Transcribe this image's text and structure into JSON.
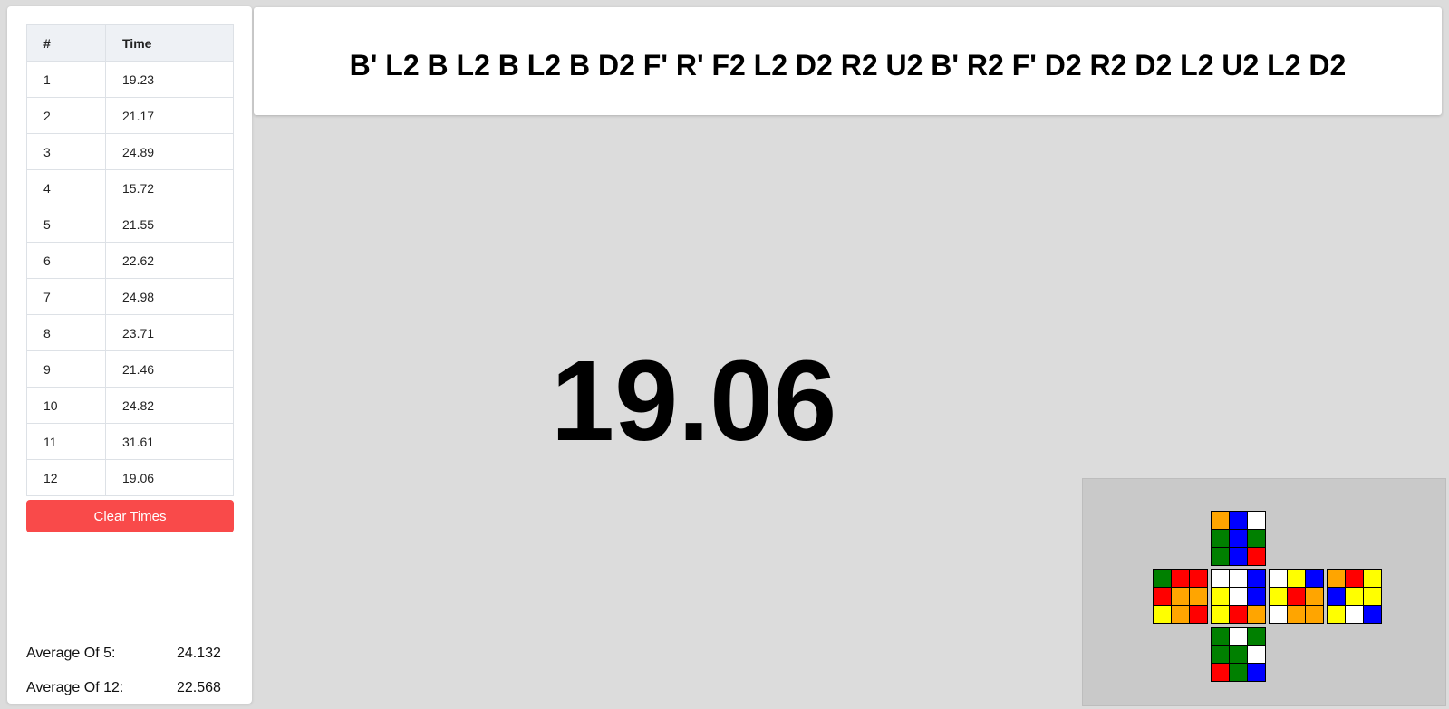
{
  "times": {
    "headers": {
      "num": "#",
      "time": "Time"
    },
    "rows": [
      {
        "num": "1",
        "time": "19.23"
      },
      {
        "num": "2",
        "time": "21.17"
      },
      {
        "num": "3",
        "time": "24.89"
      },
      {
        "num": "4",
        "time": "15.72"
      },
      {
        "num": "5",
        "time": "21.55"
      },
      {
        "num": "6",
        "time": "22.62"
      },
      {
        "num": "7",
        "time": "24.98"
      },
      {
        "num": "8",
        "time": "23.71"
      },
      {
        "num": "9",
        "time": "21.46"
      },
      {
        "num": "10",
        "time": "24.82"
      },
      {
        "num": "11",
        "time": "31.61"
      },
      {
        "num": "12",
        "time": "19.06"
      }
    ]
  },
  "clear_button": {
    "label": "Clear Times",
    "color": "#f94a4a"
  },
  "averages": {
    "ao5": {
      "label": "Average Of 5:",
      "value": "24.132"
    },
    "ao12": {
      "label": "Average Of 12:",
      "value": "22.568"
    }
  },
  "scramble": "B' L2 B L2 B L2 B D2 F' R' F2 L2 D2 R2 U2 B' R2 F' D2 R2 D2 L2 U2 L2 D2",
  "timer": "19.06",
  "colors": {
    "W": "#ffffff",
    "Y": "#ffff00",
    "R": "#ff0000",
    "O": "#ffa500",
    "B": "#0000ff",
    "G": "#008000"
  },
  "cube": {
    "U": [
      "O",
      "B",
      "W",
      "G",
      "B",
      "G",
      "G",
      "B",
      "R"
    ],
    "L": [
      "G",
      "R",
      "R",
      "R",
      "O",
      "O",
      "Y",
      "O",
      "R"
    ],
    "F": [
      "W",
      "W",
      "B",
      "Y",
      "W",
      "B",
      "Y",
      "R",
      "O"
    ],
    "R": [
      "W",
      "Y",
      "B",
      "Y",
      "R",
      "O",
      "W",
      "O",
      "O"
    ],
    "B": [
      "O",
      "R",
      "Y",
      "B",
      "Y",
      "Y",
      "Y",
      "W",
      "B"
    ],
    "D": [
      "G",
      "W",
      "G",
      "G",
      "G",
      "W",
      "R",
      "G",
      "B"
    ]
  }
}
